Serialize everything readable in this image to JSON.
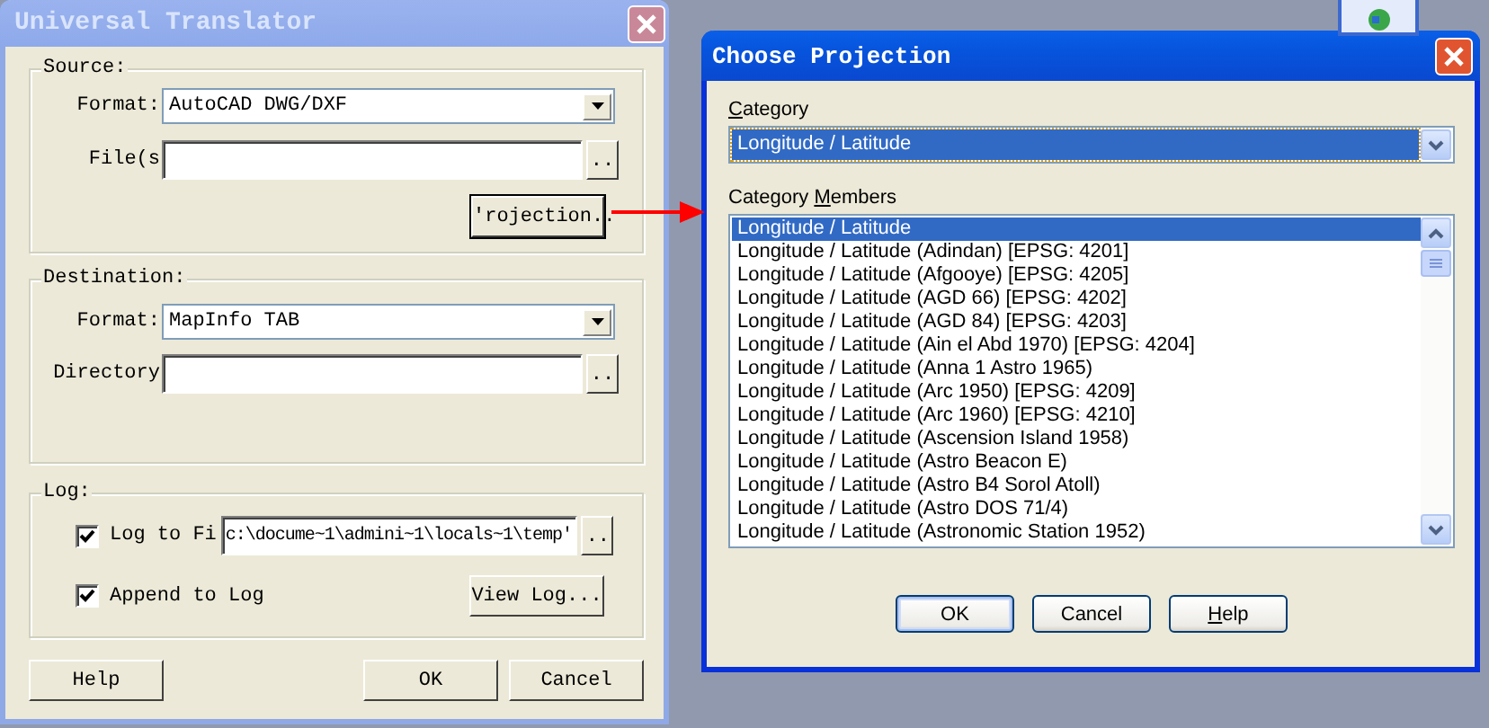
{
  "translator": {
    "title": "Universal Translator",
    "source": {
      "legend": "Source:",
      "format_label": "Format:",
      "format_value": "AutoCAD DWG/DXF",
      "files_label": "File(s",
      "browse": "..",
      "projection_button": "'rojection.."
    },
    "destination": {
      "legend": "Destination:",
      "format_label": "Format:",
      "format_value": "MapInfo TAB",
      "directory_label": "Directory",
      "browse": ".."
    },
    "log": {
      "legend": "Log:",
      "log_to_file": {
        "label": "Log to Fi",
        "checked": true
      },
      "path": "c:\\docume~1\\admini~1\\locals~1\\temp'",
      "browse": "..",
      "append": {
        "label": "Append to Log",
        "checked": true
      },
      "view_log": "View Log..."
    },
    "buttons": [
      "Help",
      "OK",
      "Cancel"
    ]
  },
  "projection_dialog": {
    "title": "Choose Projection",
    "category": {
      "label": "Category",
      "value": "Longitude / Latitude"
    },
    "members": {
      "label": "Category Members",
      "items": [
        {
          "text": "Longitude / Latitude",
          "selected": true
        },
        {
          "text": "Longitude / Latitude (Adindan) [EPSG: 4201]",
          "selected": false
        },
        {
          "text": "Longitude / Latitude (Afgooye) [EPSG: 4205]",
          "selected": false
        },
        {
          "text": "Longitude / Latitude (AGD 66) [EPSG: 4202]",
          "selected": false
        },
        {
          "text": "Longitude / Latitude (AGD 84) [EPSG: 4203]",
          "selected": false
        },
        {
          "text": "Longitude / Latitude (Ain el Abd 1970) [EPSG: 4204]",
          "selected": false
        },
        {
          "text": "Longitude / Latitude (Anna 1 Astro 1965)",
          "selected": false
        },
        {
          "text": "Longitude / Latitude (Arc 1950) [EPSG: 4209]",
          "selected": false
        },
        {
          "text": "Longitude / Latitude (Arc 1960) [EPSG: 4210]",
          "selected": false
        },
        {
          "text": "Longitude / Latitude (Ascension Island 1958)",
          "selected": false
        },
        {
          "text": "Longitude / Latitude (Astro Beacon E)",
          "selected": false
        },
        {
          "text": "Longitude / Latitude (Astro B4 Sorol Atoll)",
          "selected": false
        },
        {
          "text": "Longitude / Latitude (Astro DOS 71/4)",
          "selected": false
        },
        {
          "text": "Longitude / Latitude (Astronomic Station 1952)",
          "selected": false
        }
      ]
    },
    "buttons": [
      {
        "label": "OK",
        "default": true
      },
      {
        "label": "Cancel",
        "default": false
      },
      {
        "label": "Help",
        "default": false
      }
    ]
  }
}
